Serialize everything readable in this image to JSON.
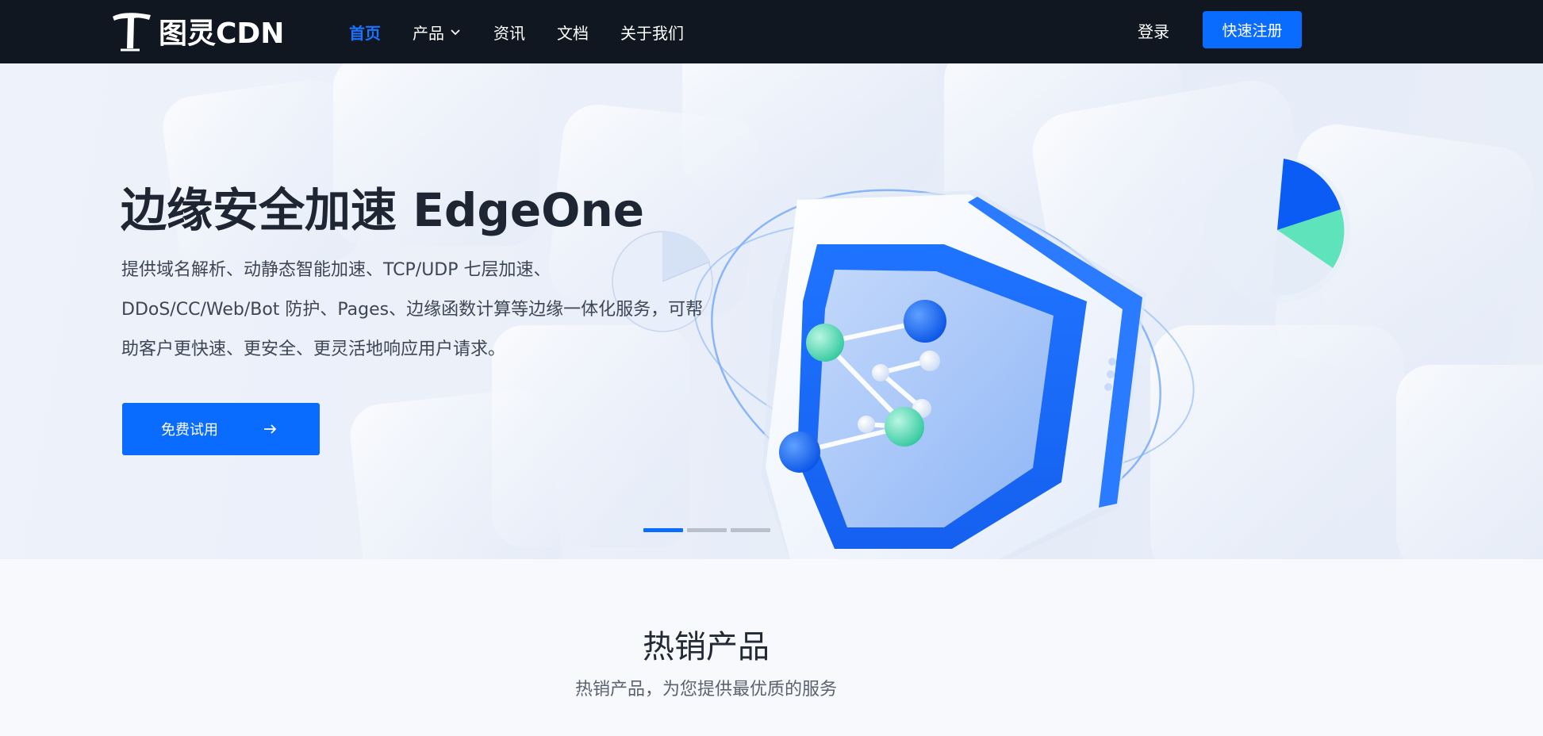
{
  "nav": {
    "logo_text": "图灵CDN",
    "items": [
      {
        "label": "首页",
        "active": true
      },
      {
        "label": "产品",
        "has_dropdown": true
      },
      {
        "label": "资讯"
      },
      {
        "label": "文档"
      },
      {
        "label": "关于我们"
      }
    ],
    "login_label": "登录",
    "register_label": "快速注册"
  },
  "hero": {
    "title": "边缘安全加速 EdgeOne",
    "description_lines": [
      "提供域名解析、动静态智能加速、TCP/UDP 七层加速、",
      "DDoS/CC/Web/Bot 防护、Pages、边缘函数计算等边缘一体化服务，可帮",
      "助客户更快速、更安全、更灵活地响应用户请求。"
    ],
    "cta_label": "免费试用",
    "cta_icon": "arrow-right-icon",
    "slides": 3,
    "active_slide": 1
  },
  "section": {
    "title": "热销产品",
    "subtitle": "热销产品，为您提供最优质的服务"
  },
  "colors": {
    "nav_bg": "#111720",
    "accent": "#0a6cff",
    "active_nav": "#1a73ff"
  }
}
